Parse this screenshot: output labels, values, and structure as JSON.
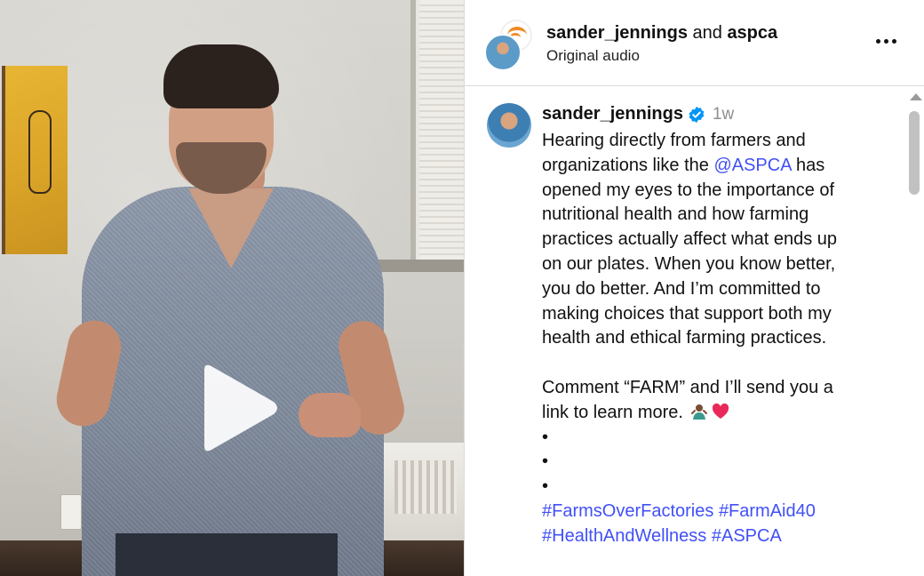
{
  "video": {
    "play_icon": "play-icon"
  },
  "header": {
    "user": "sander_jennings",
    "joiner": "and",
    "collaborator": "aspca",
    "audio": "Original audio",
    "more_icon": "more-horizontal-icon"
  },
  "caption": {
    "username": "sander_jennings",
    "verified_icon": "verified-badge-icon",
    "time": "1w",
    "lines": [
      "Hearing directly from farmers and",
      "organizations like the",
      "@ASPCA",
      "has",
      "opened my eyes to the importance of",
      "nutritional health and how farming",
      "practices actually affect what ends up",
      "on our plates. When you know better,",
      "you do better. And I’m committed to",
      "making choices that support both my",
      "health and ethical farming practices."
    ],
    "comment_line": "Comment “FARM” and I’ll send you a",
    "link_line": "link to learn more.",
    "emojis": [
      "person-gesturing-icon",
      "heart-icon"
    ],
    "bullets": [
      "•",
      "•",
      "•"
    ],
    "hashtags_row1": [
      "#FarmsOverFactories",
      "#FarmAid40"
    ],
    "hashtags_row2": [
      "#HealthAndWellness",
      "#ASPCA"
    ]
  },
  "colors": {
    "link": "#4150f7",
    "verified": "#0095f6",
    "muted": "#8e8e8e",
    "heart": "#e8295a"
  }
}
